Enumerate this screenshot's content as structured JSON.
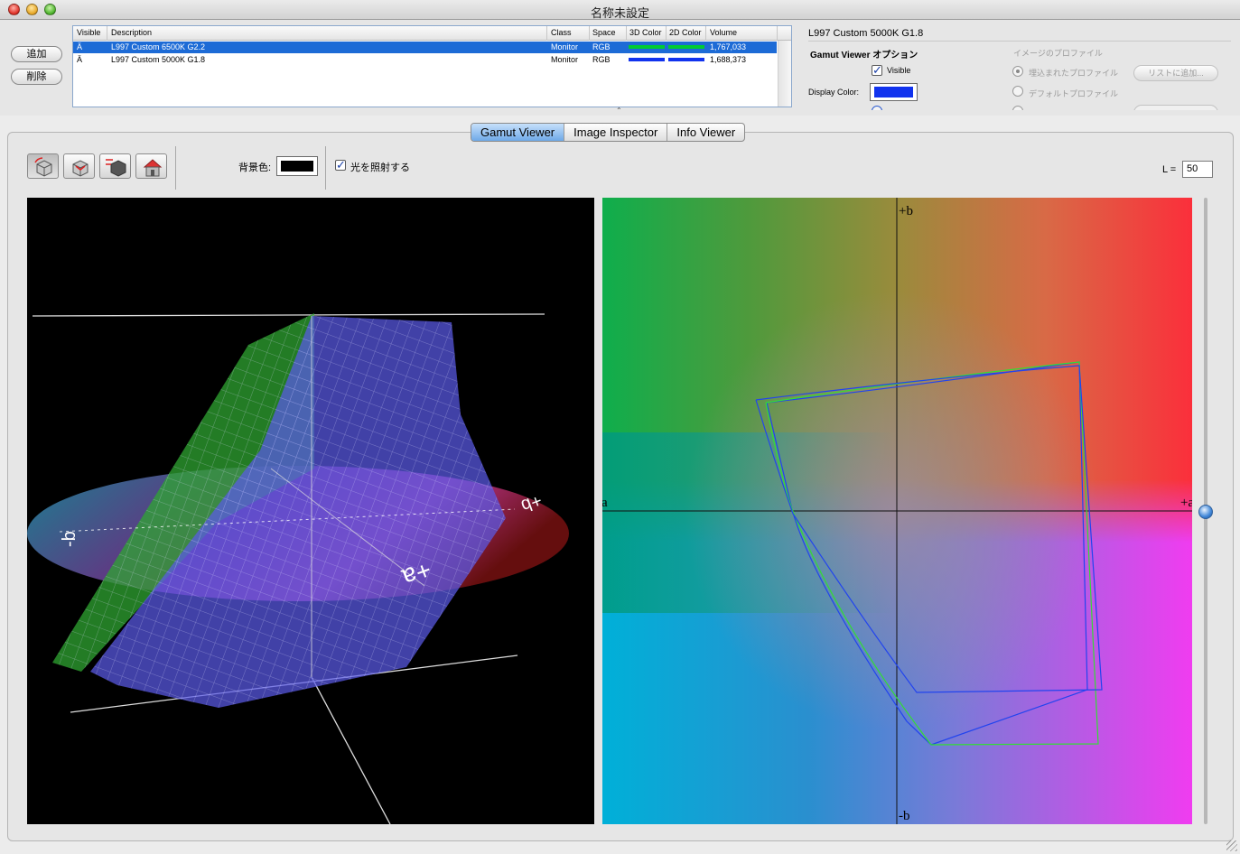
{
  "window": {
    "title": "名称未設定"
  },
  "buttons": {
    "add": "追加",
    "remove": "削除"
  },
  "table": {
    "columns": [
      "Visible",
      "Description",
      "Class",
      "Space",
      "3D Color",
      "2D Color",
      "Volume"
    ],
    "rows": [
      {
        "visible": "Ä",
        "description": "L997 Custom 6500K G2.2",
        "class": "Monitor",
        "space": "RGB",
        "color3d": "#00cc33",
        "color2d": "#00cc33",
        "volume": "1,767,033",
        "selected": true
      },
      {
        "visible": "Ä",
        "description": "L997 Custom 5000K G1.8",
        "class": "Monitor",
        "space": "RGB",
        "color3d": "#1133ee",
        "color2d": "#1133ee",
        "volume": "1,688,373",
        "selected": false
      }
    ]
  },
  "profile_panel": {
    "name": "L997 Custom 5000K G1.8",
    "options_title": "Gamut Viewer オプション",
    "visible_label": "Visible",
    "display_color_label": "Display Color:",
    "display_color": "#1133ee",
    "image_profile_title": "イメージのプロファイル",
    "embedded_label": "埋込まれたプロファイル",
    "default_label": "デフォルトプロファイル",
    "add_to_list": "リストに追加..."
  },
  "tabs": [
    {
      "label": "Gamut Viewer",
      "selected": true
    },
    {
      "label": "Image Inspector",
      "selected": false
    },
    {
      "label": "Info Viewer",
      "selected": false
    }
  ],
  "toolbar": {
    "bg_label": "背景色:",
    "bg_color": "#000000",
    "light_label": "光を照射する",
    "light_checked": true,
    "l_label": "L =",
    "l_value": "50"
  },
  "view3d": {
    "labels": {
      "plus_a": "+a",
      "minus_b": "-b",
      "plus_b": "+b"
    }
  },
  "view2d": {
    "labels": {
      "plus_b": "+b",
      "minus_b": "-b",
      "minus_a": "-a",
      "plus_a": "+a"
    }
  },
  "colors": {
    "selection": "#1d6bd6",
    "gamut_green": "#33dd33",
    "gamut_blue": "#2244ee"
  }
}
